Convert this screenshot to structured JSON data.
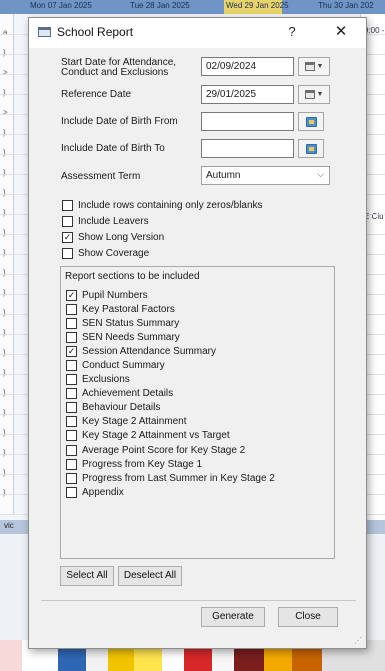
{
  "background": {
    "ribbon_texts": [
      "Mon 07 Jan 2025",
      "Tue 28 Jan 2025",
      "Wed 29 Jan 2025",
      "Thu 30 Jan 202"
    ],
    "right_texts": [
      "9:00 -",
      "E Clu"
    ],
    "left_marks": [
      "a",
      ")",
      ">",
      ")",
      ">",
      ")",
      ")",
      ")",
      ")",
      ")",
      ")",
      ")",
      ")",
      ")",
      ")",
      ")",
      ")",
      ")",
      ")",
      ")",
      ")",
      ")",
      ")",
      ")"
    ],
    "bottom_strip_text": "vic",
    "colorbar": [
      "#f7d9d9",
      "#ffffff",
      "#2f66b3",
      "#f2f2f2",
      "#f2c400",
      "#ffe44d",
      "#ffffff",
      "#d62828",
      "#f7f7f7",
      "#7a1e1e",
      "#f2a900",
      "#c86400",
      "#e0e0e0"
    ]
  },
  "dialog": {
    "title": "School Report",
    "help_label": "?",
    "close_label": "✕",
    "start_date": {
      "label_line1": "Start Date for Attendance,",
      "label_line2": "Conduct and Exclusions",
      "value": "02/09/2024"
    },
    "reference_date": {
      "label": "Reference Date",
      "value": "29/01/2025"
    },
    "dob_from": {
      "label": "Include Date of Birth From",
      "value": ""
    },
    "dob_to": {
      "label": "Include Date of Birth To",
      "value": ""
    },
    "assessment_term": {
      "label": "Assessment Term",
      "value": "Autumn"
    },
    "options": [
      {
        "label": "Include rows containing only zeros/blanks",
        "checked": false
      },
      {
        "label": "Include Leavers",
        "checked": false
      },
      {
        "label": "Show Long Version",
        "checked": true
      },
      {
        "label": "Show Coverage",
        "checked": false
      }
    ],
    "sections_header": "Report sections to be included",
    "sections": [
      {
        "label": "Pupil Numbers",
        "checked": true
      },
      {
        "label": "Key Pastoral Factors",
        "checked": false
      },
      {
        "label": "SEN Status Summary",
        "checked": false
      },
      {
        "label": "SEN Needs Summary",
        "checked": false
      },
      {
        "label": "Session Attendance Summary",
        "checked": true
      },
      {
        "label": "Conduct Summary",
        "checked": false
      },
      {
        "label": "Exclusions",
        "checked": false
      },
      {
        "label": "Achievement Details",
        "checked": false
      },
      {
        "label": "Behaviour Details",
        "checked": false
      },
      {
        "label": "Key Stage 2 Attainment",
        "checked": false
      },
      {
        "label": "Key Stage 2 Attainment vs Target",
        "checked": false
      },
      {
        "label": "Average Point Score for Key Stage 2",
        "checked": false
      },
      {
        "label": "Progress from Key Stage 1",
        "checked": false
      },
      {
        "label": "Progress from Last Summer in Key Stage 2",
        "checked": false
      },
      {
        "label": "Appendix",
        "checked": false
      }
    ],
    "select_all_label": "Select All",
    "deselect_all_label": "Deselect All",
    "generate_label": "Generate",
    "close_button_label": "Close",
    "check_glyph": "✓",
    "icons": [
      "calendar-icon",
      "folder-icon",
      "chevron-down-icon",
      "help-icon",
      "close-icon"
    ]
  }
}
